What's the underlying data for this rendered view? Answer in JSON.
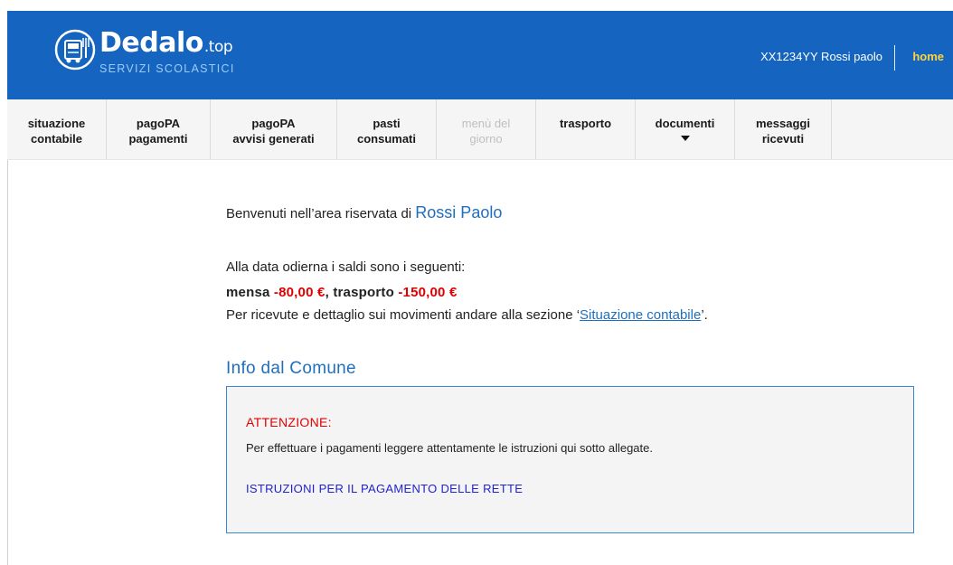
{
  "brand": {
    "name": "Dedalo",
    "tld": ".top",
    "subtitle": "SERVIZI SCOLASTICI",
    "color": "#1565c0"
  },
  "header": {
    "user_label": "XX1234YY Rossi paolo",
    "home_label": "home"
  },
  "nav": {
    "items": [
      {
        "line1": "situazione",
        "line2": "contabile"
      },
      {
        "line1": "pagoPA",
        "line2": "pagamenti"
      },
      {
        "line1": "pagoPA",
        "line2": "avvisi generati"
      },
      {
        "line1": "pasti",
        "line2": "consumati"
      },
      {
        "line1": "menù del",
        "line2": "giorno",
        "disabled": true
      },
      {
        "line1": "trasporto",
        "line2": ""
      },
      {
        "line1": "documenti",
        "line2": "",
        "dropdown": true
      },
      {
        "line1": "messaggi",
        "line2": "ricevuti"
      }
    ]
  },
  "main": {
    "welcome_text": "Benvenuti nell’area riservata di",
    "user_name": "Rossi Paolo",
    "balance_intro": "Alla data odierna i saldi sono i seguenti:",
    "mensa_label": "mensa",
    "mensa_value": "-80,00 €",
    "trasporto_label": "trasporto",
    "trasporto_value": "-150,00 €",
    "detail_prefix": "Per ricevute e dettaglio sui movimenti andare alla sezione ‘",
    "detail_link": "Situazione contabile",
    "detail_suffix": "’."
  },
  "info": {
    "title": "Info dal Comune",
    "warning": "ATTENZIONE:",
    "text": "Per effettuare i pagamenti leggere attentamente le istruzioni qui sotto allegate.",
    "link": "ISTRUZIONI PER IL PAGAMENTO DELLE RETTE"
  },
  "colors": {
    "accent": "#1f6fbf",
    "negative": "#e00000",
    "home_link": "#ffd43a"
  }
}
